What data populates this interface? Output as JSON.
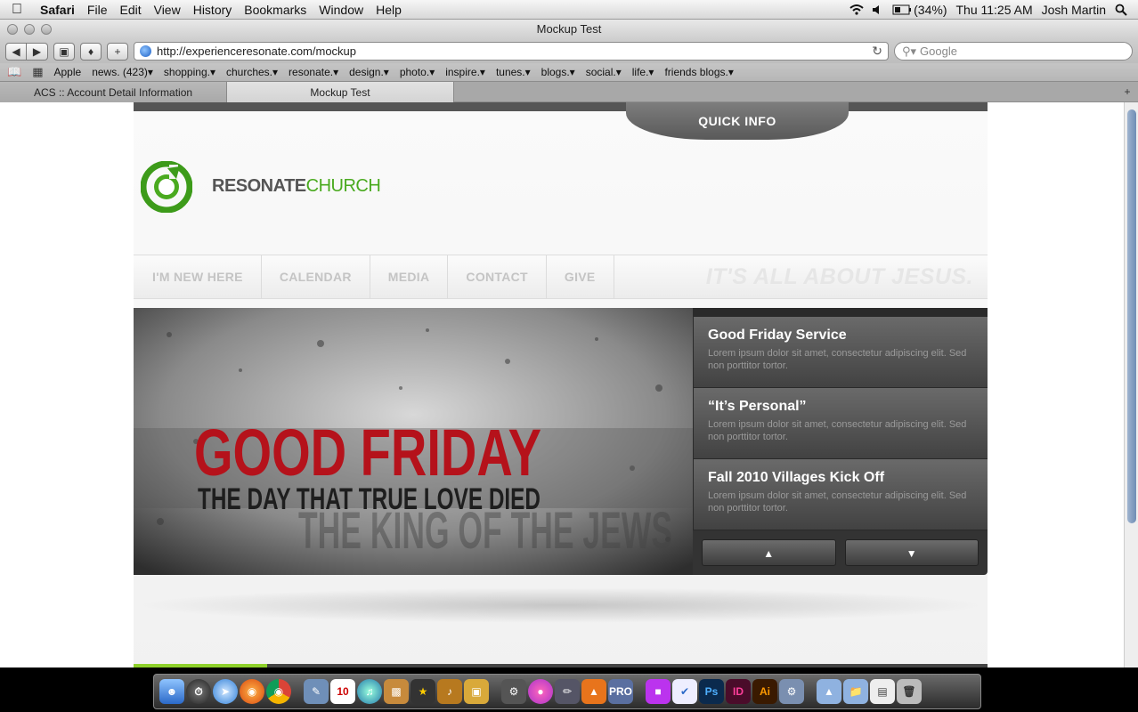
{
  "menubar": {
    "app": "Safari",
    "items": [
      "File",
      "Edit",
      "View",
      "History",
      "Bookmarks",
      "Window",
      "Help"
    ],
    "battery": "(34%)",
    "clock": "Thu 11:25 AM",
    "user": "Josh Martin"
  },
  "window": {
    "title": "Mockup Test"
  },
  "toolbar": {
    "url": "http://experienceresonate.com/mockup",
    "search_placeholder": "Google"
  },
  "bookmarks": [
    "Apple",
    "news. (423)▾",
    "shopping.▾",
    "churches.▾",
    "resonate.▾",
    "design.▾",
    "photo.▾",
    "inspire.▾",
    "tunes.▾",
    "blogs.▾",
    "social.▾",
    "life.▾",
    "friends blogs.▾"
  ],
  "tabs": [
    {
      "label": "ACS :: Account Detail Information"
    },
    {
      "label": "Mockup Test"
    }
  ],
  "site": {
    "quick_info": "QUICK INFO",
    "brand_main": "RESONATE",
    "brand_accent": "CHURCH",
    "nav": [
      "I'M NEW HERE",
      "CALENDAR",
      "MEDIA",
      "CONTACT",
      "GIVE"
    ],
    "tagline": "IT'S ALL ABOUT JESUS.",
    "hero": {
      "headline": "GOOD FRIDAY",
      "subline": "THE DAY THAT TRUE LOVE DIED",
      "background_text": "THE KING OF THE JEWS"
    },
    "events": [
      {
        "title": "Good Friday Service",
        "desc": "Lorem ipsum dolor sit amet, consectetur adipiscing elit. Sed non porttitor tortor."
      },
      {
        "title": "“It’s Personal”",
        "desc": "Lorem ipsum dolor sit amet, consectetur adipiscing elit. Sed non porttitor tortor."
      },
      {
        "title": "Fall 2010 Villages Kick Off",
        "desc": "Lorem ipsum dolor sit amet, consectetur adipiscing elit. Sed non porttitor tortor."
      }
    ],
    "arrow_up": "▲",
    "arrow_down": "▼"
  },
  "dock": {
    "labels": [
      "Ps",
      "ID",
      "Ai",
      "PRO"
    ]
  },
  "colors": {
    "brand_green": "#4aaa1f",
    "accent_green": "#8ed12a",
    "headline_red": "#b5121b"
  }
}
